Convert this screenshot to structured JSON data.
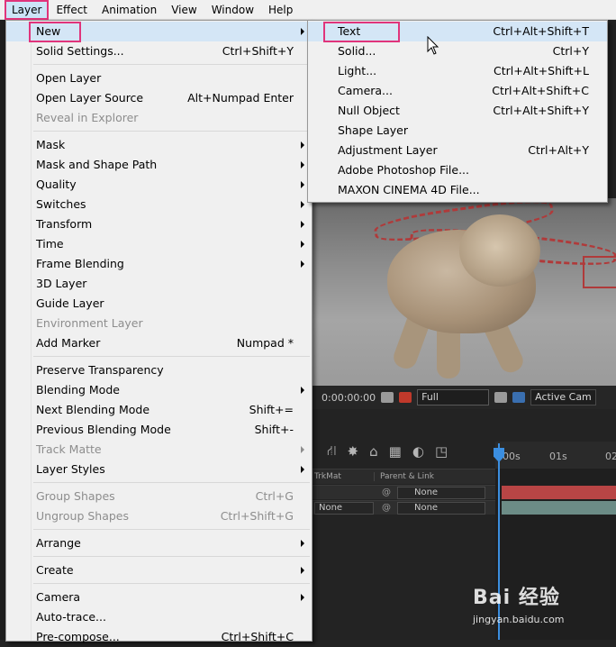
{
  "menubar": {
    "items": [
      "Layer",
      "Effect",
      "Animation",
      "View",
      "Window",
      "Help"
    ],
    "active": "Layer"
  },
  "layer_menu": {
    "items": [
      {
        "label": "New",
        "shortcut": "",
        "submenu": true,
        "disabled": false,
        "highlighted": true
      },
      {
        "label": "Solid Settings...",
        "shortcut": "Ctrl+Shift+Y",
        "submenu": false,
        "disabled": false
      },
      {
        "label": "Open Layer",
        "shortcut": "",
        "submenu": false,
        "disabled": false
      },
      {
        "label": "Open Layer Source",
        "shortcut": "Alt+Numpad Enter",
        "submenu": false,
        "disabled": false
      },
      {
        "label": "Reveal in Explorer",
        "shortcut": "",
        "submenu": false,
        "disabled": true
      },
      {
        "label": "Mask",
        "shortcut": "",
        "submenu": true,
        "disabled": false
      },
      {
        "label": "Mask and Shape Path",
        "shortcut": "",
        "submenu": true,
        "disabled": false
      },
      {
        "label": "Quality",
        "shortcut": "",
        "submenu": true,
        "disabled": false
      },
      {
        "label": "Switches",
        "shortcut": "",
        "submenu": true,
        "disabled": false
      },
      {
        "label": "Transform",
        "shortcut": "",
        "submenu": true,
        "disabled": false
      },
      {
        "label": "Time",
        "shortcut": "",
        "submenu": true,
        "disabled": false
      },
      {
        "label": "Frame Blending",
        "shortcut": "",
        "submenu": true,
        "disabled": false
      },
      {
        "label": "3D Layer",
        "shortcut": "",
        "submenu": false,
        "disabled": false
      },
      {
        "label": "Guide Layer",
        "shortcut": "",
        "submenu": false,
        "disabled": false
      },
      {
        "label": "Environment Layer",
        "shortcut": "",
        "submenu": false,
        "disabled": true
      },
      {
        "label": "Add Marker",
        "shortcut": "Numpad *",
        "submenu": false,
        "disabled": false
      },
      {
        "label": "Preserve Transparency",
        "shortcut": "",
        "submenu": false,
        "disabled": false
      },
      {
        "label": "Blending Mode",
        "shortcut": "",
        "submenu": true,
        "disabled": false
      },
      {
        "label": "Next Blending Mode",
        "shortcut": "Shift+=",
        "submenu": false,
        "disabled": false
      },
      {
        "label": "Previous Blending Mode",
        "shortcut": "Shift+-",
        "submenu": false,
        "disabled": false
      },
      {
        "label": "Track Matte",
        "shortcut": "",
        "submenu": true,
        "disabled": true
      },
      {
        "label": "Layer Styles",
        "shortcut": "",
        "submenu": true,
        "disabled": false
      },
      {
        "label": "Group Shapes",
        "shortcut": "Ctrl+G",
        "submenu": false,
        "disabled": true
      },
      {
        "label": "Ungroup Shapes",
        "shortcut": "Ctrl+Shift+G",
        "submenu": false,
        "disabled": true
      },
      {
        "label": "Arrange",
        "shortcut": "",
        "submenu": true,
        "disabled": false
      },
      {
        "label": "Create",
        "shortcut": "",
        "submenu": true,
        "disabled": false
      },
      {
        "label": "Camera",
        "shortcut": "",
        "submenu": true,
        "disabled": false
      },
      {
        "label": "Auto-trace...",
        "shortcut": "",
        "submenu": false,
        "disabled": false
      },
      {
        "label": "Pre-compose...",
        "shortcut": "Ctrl+Shift+C",
        "submenu": false,
        "disabled": false
      }
    ]
  },
  "new_submenu": {
    "items": [
      {
        "label": "Text",
        "shortcut": "Ctrl+Alt+Shift+T",
        "highlighted": true
      },
      {
        "label": "Solid...",
        "shortcut": "Ctrl+Y"
      },
      {
        "label": "Light...",
        "shortcut": "Ctrl+Alt+Shift+L"
      },
      {
        "label": "Camera...",
        "shortcut": "Ctrl+Alt+Shift+C"
      },
      {
        "label": "Null Object",
        "shortcut": "Ctrl+Alt+Shift+Y"
      },
      {
        "label": "Shape Layer",
        "shortcut": ""
      },
      {
        "label": "Adjustment Layer",
        "shortcut": "Ctrl+Alt+Y"
      },
      {
        "label": "Adobe Photoshop File...",
        "shortcut": ""
      },
      {
        "label": "MAXON CINEMA 4D File...",
        "shortcut": ""
      }
    ]
  },
  "viewer": {
    "timecode": "0:00:00:00",
    "resolution": "Full",
    "camera": "Active Cam"
  },
  "timeline": {
    "col_trkmat": "TrkMat",
    "col_parent": "Parent & Link",
    "rows": [
      {
        "trkmat": "",
        "parent": "None"
      },
      {
        "trkmat": "None",
        "parent": "None"
      }
    ],
    "ruler": [
      "00s",
      "01s",
      "02"
    ],
    "colors": {
      "bar1": "#b84545",
      "bar2": "#6c8c86",
      "playhead": "#3b8ee0"
    }
  },
  "watermark": {
    "logo": "Bai 经验",
    "url": "jingyan.baidu.com"
  },
  "colors": {
    "highlight_box": "#e0347b",
    "menu_bg": "#f0f0f0",
    "menu_hover": "#d4e6f6"
  }
}
